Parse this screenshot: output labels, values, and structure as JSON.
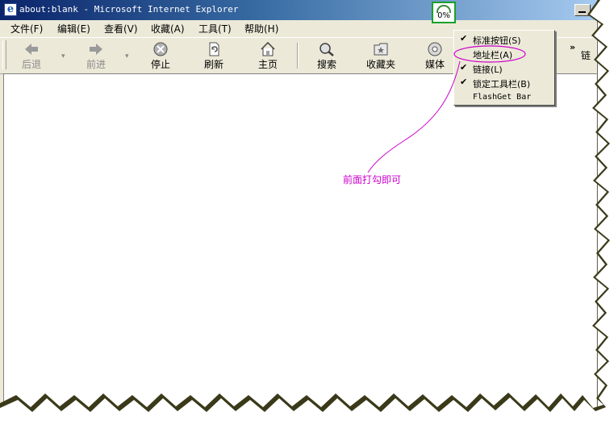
{
  "window": {
    "title": "about:blank - Microsoft Internet Explorer",
    "app_icon": "ie-page-icon"
  },
  "progress_badge": {
    "text": "0%"
  },
  "menu_bar": {
    "items": [
      {
        "label": "文件(F)"
      },
      {
        "label": "编辑(E)"
      },
      {
        "label": "查看(V)"
      },
      {
        "label": "收藏(A)"
      },
      {
        "label": "工具(T)"
      },
      {
        "label": "帮助(H)"
      }
    ]
  },
  "toolbar": {
    "buttons": [
      {
        "label": "后退",
        "icon": "back-arrow-icon",
        "enabled": false
      },
      {
        "label": "前进",
        "icon": "forward-arrow-icon",
        "enabled": false
      },
      {
        "label": "停止",
        "icon": "stop-icon",
        "enabled": true
      },
      {
        "label": "刷新",
        "icon": "refresh-icon",
        "enabled": true
      },
      {
        "label": "主页",
        "icon": "home-icon",
        "enabled": true
      },
      {
        "label": "搜索",
        "icon": "search-icon",
        "enabled": true
      },
      {
        "label": "收藏夹",
        "icon": "favorites-icon",
        "enabled": true
      },
      {
        "label": "媒体",
        "icon": "media-icon",
        "enabled": true
      }
    ],
    "overflow_glyph": "»",
    "links_label": "链"
  },
  "context_menu": {
    "items": [
      {
        "label": "标准按钮(S)",
        "checked": true
      },
      {
        "label": "地址栏(A)",
        "checked": false,
        "highlighted": true
      },
      {
        "label": "链接(L)",
        "checked": true
      },
      {
        "label": "锁定工具栏(B)",
        "checked": true
      },
      {
        "label": "FlashGet Bar",
        "checked": false
      }
    ],
    "check_glyph": "✔"
  },
  "annotation": {
    "text": "前面打勾即可",
    "color": "#cc00cc"
  },
  "colors": {
    "title_gradient_start": "#0a246a",
    "title_gradient_end": "#a6caf0",
    "chrome": "#ece9d8",
    "badge_border": "#19a02a"
  }
}
